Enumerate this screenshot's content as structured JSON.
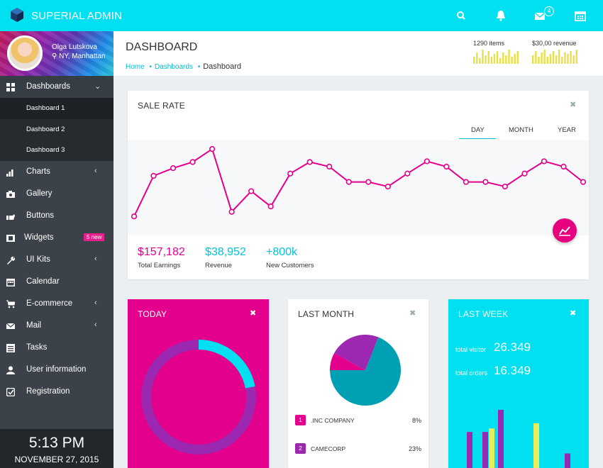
{
  "app": {
    "brand": "SUPERIAL ADMIN",
    "accent": "#00e0f0",
    "magenta": "#e3008c"
  },
  "topbar": {
    "icons": [
      "search-icon",
      "bell-icon",
      "mail-icon",
      "calendar-icon"
    ],
    "mail_badge": "4"
  },
  "profile": {
    "name": "Olga Lutskova",
    "location": "NY, Manhattan"
  },
  "sidebar": {
    "items": [
      {
        "label": "Dashboards",
        "icon": "grid-icon",
        "arrow": "⌄"
      },
      {
        "label": "Charts",
        "icon": "bar-chart-icon",
        "arrow": "‹"
      },
      {
        "label": "Gallery",
        "icon": "camera-icon",
        "arrow": ""
      },
      {
        "label": "Buttons",
        "icon": "hand-pointer-icon",
        "arrow": ""
      },
      {
        "label": "Widgets",
        "icon": "film-icon",
        "arrow": "",
        "badge": "5 new"
      },
      {
        "label": "UI Kits",
        "icon": "wrench-icon",
        "arrow": "‹"
      },
      {
        "label": "Calendar",
        "icon": "calendar-icon",
        "arrow": ""
      },
      {
        "label": "E-commerce",
        "icon": "cart-icon",
        "arrow": "‹"
      },
      {
        "label": "Mail",
        "icon": "envelope-icon",
        "arrow": "‹"
      },
      {
        "label": "Tasks",
        "icon": "list-icon",
        "arrow": ""
      },
      {
        "label": "User information",
        "icon": "user-icon",
        "arrow": ""
      },
      {
        "label": "Registration",
        "icon": "check-square-icon",
        "arrow": ""
      }
    ],
    "subitems": [
      "Dashboard 1",
      "Dashboard 2",
      "Dashboard 3"
    ]
  },
  "clock": {
    "time": "5:13 PM",
    "date": "NOVEMBER 27, 2015"
  },
  "header": {
    "title": "DASHBOARD",
    "breadcrumb": [
      "Home",
      "Dashboards",
      "Dashboard"
    ],
    "stats": [
      {
        "label": "1290 items",
        "bars": [
          0.5,
          0.8,
          0.4,
          1.0,
          0.6,
          0.9,
          0.5,
          0.7,
          0.9,
          0.4,
          0.8,
          0.6,
          1.0,
          0.5,
          0.7,
          0.9
        ]
      },
      {
        "label": "$30,00 revenue",
        "bars": [
          0.6,
          0.9,
          0.5,
          0.8,
          1.0,
          0.5,
          0.7,
          0.9,
          0.6,
          1.0,
          0.5,
          0.8,
          0.7,
          0.9,
          0.6,
          1.0
        ]
      }
    ]
  },
  "sale_rate": {
    "title": "SALE RATE",
    "tabs": [
      "DAY",
      "MONTH",
      "YEAR"
    ],
    "active_tab": "DAY",
    "kpis": [
      {
        "value": "$157,182",
        "label": "Total Earnings",
        "color": "#e3008c"
      },
      {
        "value": "$38,952",
        "label": "Revenue",
        "color": "#00c4d8"
      },
      {
        "value": "+800k",
        "label": "New Customers",
        "color": "#00c4d8"
      }
    ]
  },
  "chart_data": {
    "type": "line",
    "title": "",
    "xlabel": "",
    "ylabel": "",
    "series": [
      {
        "values": [
          10,
          63,
          73,
          81,
          98,
          16,
          43,
          23,
          66,
          81,
          75,
          55,
          55,
          49,
          66,
          82,
          75,
          55,
          55,
          49,
          66,
          82,
          75,
          55
        ]
      }
    ],
    "ylim": [
      0,
      100
    ],
    "grid": false,
    "line_color": "#e3008c"
  },
  "today": {
    "title": "TODAY",
    "donut_fraction": 0.22,
    "colors": [
      "#00e0f0",
      "#9c27b0"
    ]
  },
  "last_month": {
    "title": "LAST MONTH",
    "pie": [
      {
        "name": ".INC COMPANY",
        "value": 8,
        "color": "#e3008c"
      },
      {
        "name": "CAMECORP",
        "value": 23,
        "color": "#9c27b0"
      },
      {
        "name": "",
        "value": 69,
        "color": "#00a0b4"
      }
    ],
    "legend": [
      {
        "num": "1",
        "name": ".INC COMPANY",
        "pct": "8%",
        "color": "#e3008c"
      },
      {
        "num": "2",
        "name": "CAMECORP",
        "pct": "23%",
        "color": "#9c27b0"
      }
    ]
  },
  "last_week": {
    "title": "LAST WEEK",
    "total_visitor_label": "total visitor",
    "total_visitor": "26.349",
    "total_orders_label": "total orders",
    "total_orders": "16.349",
    "bars": [
      {
        "value": 0.62,
        "color": "#9c27b0"
      },
      {
        "value": 0.62,
        "color": "#9c27b0"
      },
      {
        "value": 0.68,
        "color": "#e8ee5a"
      },
      {
        "value": 1.0,
        "color": "#9c27b0"
      },
      {
        "value": 0.77,
        "color": "#e8ee5a"
      },
      {
        "value": 0.25,
        "color": "#9c27b0"
      }
    ]
  }
}
